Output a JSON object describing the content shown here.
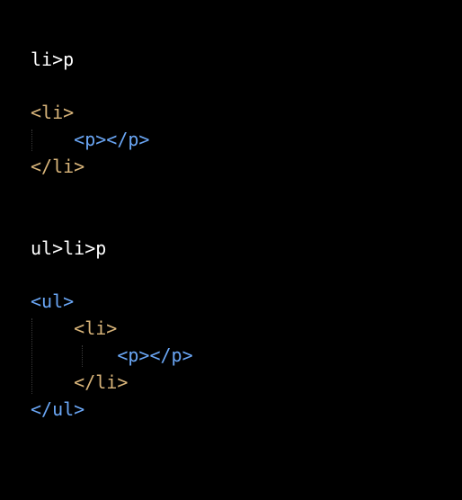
{
  "example1": {
    "abbreviation": "li>p",
    "lines": [
      "<li>",
      "    <p></p>",
      "</li>"
    ]
  },
  "example2": {
    "abbreviation": "ul>li>p",
    "lines": [
      "<ul>",
      "    <li>",
      "        <p></p>",
      "    </li>",
      "</ul>"
    ]
  },
  "colors": {
    "background": "#000000",
    "abbreviation": "#ffffff",
    "li_tag": "#d9b57a",
    "p_tag": "#6aa6f5",
    "ul_tag": "#6aa6f5"
  }
}
